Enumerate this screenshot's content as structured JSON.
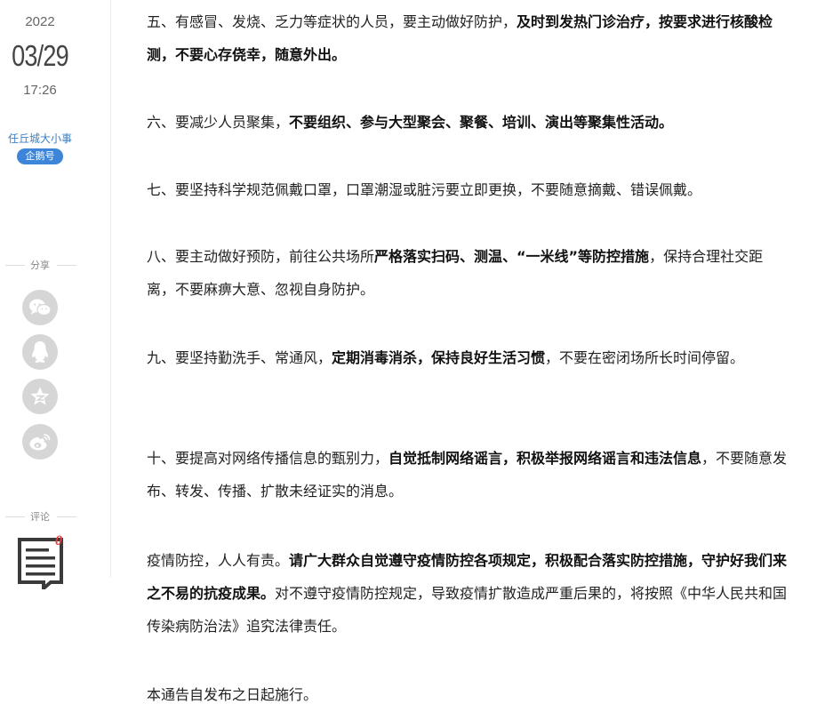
{
  "meta": {
    "year": "2022",
    "month_day": "03/29",
    "time": "17:26",
    "author": "任丘城大小事",
    "badge": "企鹅号"
  },
  "share": {
    "label": "分享",
    "buttons": [
      "wechat-icon",
      "qq-icon",
      "qzone-icon",
      "weibo-icon"
    ]
  },
  "comments": {
    "label": "评论",
    "count": "0"
  },
  "colors": {
    "accent": "#3d85d8",
    "author_link": "#3b7fc4",
    "comment_count": "#e63d3d",
    "share_icon_bg": "#d6d6d6"
  },
  "article": {
    "p5": {
      "a": "五、有感冒、发烧、乏力等症状的人员，要主动做好防护，",
      "b": "及时到发热门诊治疗，按要求进行核酸检测，不要心存侥幸，随意外出。"
    },
    "p6": {
      "a": "六、要减少人员聚集，",
      "b": "不要组织、参与大型聚会、聚餐、培训、演出等聚集性活动。"
    },
    "p7": {
      "a": "七、要坚持科学规范佩戴口罩，口罩潮湿或脏污要立即更换，不要随意摘戴、错误佩戴。"
    },
    "p8": {
      "a": "八、要主动做好预防，前往公共场所",
      "b": "严格落实扫码、测温、“一米线”等防控措施",
      "c": "，保持合理社交距离，不要麻痹大意、忽视自身防护。"
    },
    "p9": {
      "a": "九、要坚持勤洗手、常通风，",
      "b": "定期消毒消杀，保持良好生活习惯",
      "c": "，不要在密闭场所长时间停留。"
    },
    "p10": {
      "a": "十、要提高对网络传播信息的甄别力，",
      "b": "自觉抵制网络谣言，积极举报网络谣言和违法信息",
      "c": "，不要随意发布、转发、传播、扩散未经证实的消息。"
    },
    "p11": {
      "a": "疫情防控，人人有责。",
      "b": "请广大群众自觉遵守疫情防控各项规定，积极配合落实防控措施，守护好我们来之不易的抗疫成果。",
      "c": "对不遵守疫情防控规定，导致疫情扩散造成严重后果的，将按照《中华人民共和国传染病防治法》追究法律责任。"
    },
    "p12": {
      "a": "本通告自发布之日起施行。"
    }
  }
}
